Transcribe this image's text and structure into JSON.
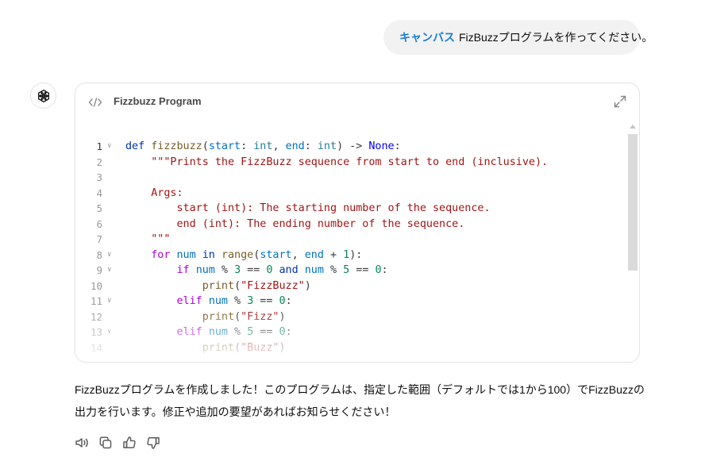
{
  "user_message": {
    "canvas_tag": "キャンバス",
    "text": "FizBuzzプログラムを作ってください。"
  },
  "canvas": {
    "title": "Fizzbuzz Program",
    "code_lines": [
      {
        "n": "1",
        "fold": true,
        "tokens": [
          [
            "def",
            "k-def"
          ],
          [
            " ",
            ""
          ],
          [
            "fizzbuzz",
            "k-fn"
          ],
          [
            "(",
            ""
          ],
          [
            "start",
            "k-param"
          ],
          [
            ": ",
            ""
          ],
          [
            "int",
            "k-type"
          ],
          [
            ", ",
            ""
          ],
          [
            "end",
            "k-param"
          ],
          [
            ": ",
            ""
          ],
          [
            "int",
            "k-type"
          ],
          [
            ") -> ",
            ""
          ],
          [
            "None",
            "k-none"
          ],
          [
            ":",
            ""
          ]
        ]
      },
      {
        "n": "2",
        "fold": false,
        "tokens": [
          [
            "    \"\"\"Prints the FizzBuzz sequence from start to end (inclusive).",
            "k-str"
          ]
        ]
      },
      {
        "n": "3",
        "fold": false,
        "tokens": [
          [
            "",
            ""
          ]
        ]
      },
      {
        "n": "4",
        "fold": false,
        "tokens": [
          [
            "    Args:",
            "k-str"
          ]
        ]
      },
      {
        "n": "5",
        "fold": false,
        "tokens": [
          [
            "        start (int): The starting number of the sequence.",
            "k-str"
          ]
        ]
      },
      {
        "n": "6",
        "fold": false,
        "tokens": [
          [
            "        end (int): The ending number of the sequence.",
            "k-str"
          ]
        ]
      },
      {
        "n": "7",
        "fold": false,
        "tokens": [
          [
            "    \"\"\"",
            "k-str"
          ]
        ]
      },
      {
        "n": "8",
        "fold": true,
        "tokens": [
          [
            "    ",
            ""
          ],
          [
            "for",
            "k-ctrl"
          ],
          [
            " ",
            ""
          ],
          [
            "num",
            "k-param"
          ],
          [
            " ",
            ""
          ],
          [
            "in",
            "k-def"
          ],
          [
            " ",
            ""
          ],
          [
            "range",
            "k-bi"
          ],
          [
            "(",
            ""
          ],
          [
            "start",
            "k-param"
          ],
          [
            ", ",
            ""
          ],
          [
            "end",
            "k-param"
          ],
          [
            " + ",
            ""
          ],
          [
            "1",
            "k-num"
          ],
          [
            "):",
            ""
          ]
        ]
      },
      {
        "n": "9",
        "fold": true,
        "tokens": [
          [
            "        ",
            ""
          ],
          [
            "if",
            "k-ctrl"
          ],
          [
            " ",
            ""
          ],
          [
            "num",
            "k-param"
          ],
          [
            " % ",
            ""
          ],
          [
            "3",
            "k-num"
          ],
          [
            " == ",
            ""
          ],
          [
            "0",
            "k-num"
          ],
          [
            " ",
            ""
          ],
          [
            "and",
            "k-def"
          ],
          [
            " ",
            ""
          ],
          [
            "num",
            "k-param"
          ],
          [
            " % ",
            ""
          ],
          [
            "5",
            "k-num"
          ],
          [
            " == ",
            ""
          ],
          [
            "0",
            "k-num"
          ],
          [
            ":",
            ""
          ]
        ]
      },
      {
        "n": "10",
        "fold": false,
        "tokens": [
          [
            "            ",
            ""
          ],
          [
            "print",
            "k-bi"
          ],
          [
            "(",
            ""
          ],
          [
            "\"FizzBuzz\"",
            "k-str"
          ],
          [
            ")",
            ""
          ]
        ]
      },
      {
        "n": "11",
        "fold": true,
        "tokens": [
          [
            "        ",
            ""
          ],
          [
            "elif",
            "k-ctrl"
          ],
          [
            " ",
            ""
          ],
          [
            "num",
            "k-param"
          ],
          [
            " % ",
            ""
          ],
          [
            "3",
            "k-num"
          ],
          [
            " == ",
            ""
          ],
          [
            "0",
            "k-num"
          ],
          [
            ":",
            ""
          ]
        ]
      },
      {
        "n": "12",
        "fold": false,
        "tokens": [
          [
            "            ",
            ""
          ],
          [
            "print",
            "k-bi"
          ],
          [
            "(",
            ""
          ],
          [
            "\"Fizz\"",
            "k-str"
          ],
          [
            ")",
            ""
          ]
        ]
      },
      {
        "n": "13",
        "fold": true,
        "tokens": [
          [
            "        ",
            ""
          ],
          [
            "elif",
            "k-ctrl"
          ],
          [
            " ",
            ""
          ],
          [
            "num",
            "k-param"
          ],
          [
            " % ",
            ""
          ],
          [
            "5",
            "k-num"
          ],
          [
            " == ",
            ""
          ],
          [
            "0",
            "k-num"
          ],
          [
            ":",
            ""
          ]
        ]
      },
      {
        "n": "14",
        "fold": false,
        "tokens": [
          [
            "            ",
            ""
          ],
          [
            "print",
            "k-bi"
          ],
          [
            "(",
            ""
          ],
          [
            "\"Buzz\"",
            "k-str"
          ],
          [
            ")",
            ""
          ]
        ]
      }
    ]
  },
  "response": {
    "text": "FizzBuzzプログラムを作成しました！このプログラムは、指定した範囲（デフォルトでは1から100）でFizzBuzzの出力を行います。修正や追加の要望があればお知らせください！"
  },
  "actions": [
    {
      "name": "read-aloud-icon"
    },
    {
      "name": "copy-icon"
    },
    {
      "name": "thumbs-up-icon"
    },
    {
      "name": "thumbs-down-icon"
    }
  ],
  "colors": {
    "canvas_tag": "#1a7fd6",
    "user_bubble_bg": "#f2f2f2"
  }
}
